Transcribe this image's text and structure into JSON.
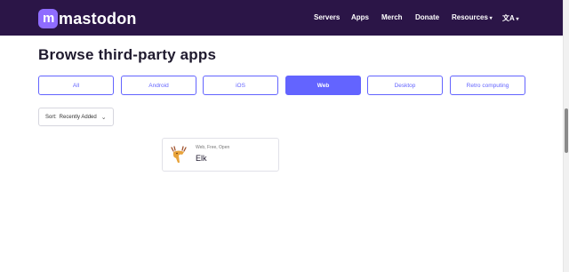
{
  "nav": {
    "logo_text": "mastodon",
    "links": [
      "Servers",
      "Apps",
      "Merch",
      "Donate",
      "Resources",
      "文A"
    ]
  },
  "page": {
    "title": "Browse third-party apps"
  },
  "filters": {
    "items": [
      "All",
      "Android",
      "iOS",
      "Web",
      "Desktop",
      "Retro computing"
    ],
    "active": "Web"
  },
  "sort": {
    "label": "Sort:",
    "value": "Recently Added"
  },
  "app": {
    "meta": "Web, Free, Open",
    "name": "Elk"
  },
  "colors": {
    "nav_bg": "#2b1547",
    "accent": "#6364ff"
  }
}
